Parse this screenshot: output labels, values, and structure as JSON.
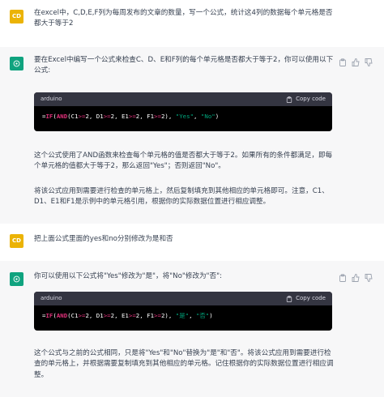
{
  "messages": [
    {
      "role": "user",
      "avatar": "CD",
      "text": "在excel中，C,D,E,F列为每周发布的文章的数量，写一个公式，统计这4列的数据每个单元格是否都大于等于2"
    },
    {
      "role": "assistant",
      "intro": "要在Excel中编写一个公式来检查C、D、E和F列的每个单元格是否都大于等于2，你可以使用以下公式:",
      "code": {
        "language": "arduino",
        "copy_label": "Copy code",
        "tokens": [
          {
            "t": "=",
            "c": "plain"
          },
          {
            "t": "IF",
            "c": "kw"
          },
          {
            "t": "(",
            "c": "plain"
          },
          {
            "t": "AND",
            "c": "kw"
          },
          {
            "t": "(C1",
            "c": "plain"
          },
          {
            "t": ">=",
            "c": "op"
          },
          {
            "t": "2",
            "c": "num"
          },
          {
            "t": ", D1",
            "c": "plain"
          },
          {
            "t": ">=",
            "c": "op"
          },
          {
            "t": "2",
            "c": "num"
          },
          {
            "t": ", E1",
            "c": "plain"
          },
          {
            "t": ">=",
            "c": "op"
          },
          {
            "t": "2",
            "c": "num"
          },
          {
            "t": ", F1",
            "c": "plain"
          },
          {
            "t": ">=",
            "c": "op"
          },
          {
            "t": "2",
            "c": "num"
          },
          {
            "t": "), ",
            "c": "plain"
          },
          {
            "t": "\"Yes\"",
            "c": "str"
          },
          {
            "t": ", ",
            "c": "plain"
          },
          {
            "t": "\"No\"",
            "c": "str"
          },
          {
            "t": ")",
            "c": "plain"
          }
        ]
      },
      "para1": "这个公式使用了AND函数来检查每个单元格的值是否都大于等于2。如果所有的条件都满足，即每个单元格的值都大于等于2，那么返回\"Yes\"；否则返回\"No\"。",
      "para2": "将该公式应用到需要进行检查的单元格上，然后复制填充到其他相应的单元格即可。注意，C1、D1、E1和F1是示例中的单元格引用，根据你的实际数据位置进行相应调整。"
    },
    {
      "role": "user",
      "avatar": "CD",
      "text": "把上面公式里面的yes和no分别修改为是和否"
    },
    {
      "role": "assistant",
      "intro": "你可以使用以下公式将\"Yes\"修改为\"是\"，将\"No\"修改为\"否\":",
      "code": {
        "language": "arduino",
        "copy_label": "Copy code",
        "tokens": [
          {
            "t": "=",
            "c": "plain"
          },
          {
            "t": "IF",
            "c": "kw"
          },
          {
            "t": "(",
            "c": "plain"
          },
          {
            "t": "AND",
            "c": "kw"
          },
          {
            "t": "(C1",
            "c": "plain"
          },
          {
            "t": ">=",
            "c": "op"
          },
          {
            "t": "2",
            "c": "num"
          },
          {
            "t": ", D1",
            "c": "plain"
          },
          {
            "t": ">=",
            "c": "op"
          },
          {
            "t": "2",
            "c": "num"
          },
          {
            "t": ", E1",
            "c": "plain"
          },
          {
            "t": ">=",
            "c": "op"
          },
          {
            "t": "2",
            "c": "num"
          },
          {
            "t": ", F1",
            "c": "plain"
          },
          {
            "t": ">=",
            "c": "op"
          },
          {
            "t": "2",
            "c": "num"
          },
          {
            "t": "), ",
            "c": "plain"
          },
          {
            "t": "\"是\"",
            "c": "str"
          },
          {
            "t": ", ",
            "c": "plain"
          },
          {
            "t": "\"否\"",
            "c": "str"
          },
          {
            "t": ")",
            "c": "plain"
          }
        ]
      },
      "para1": "这个公式与之前的公式相同，只是将\"Yes\"和\"No\"替换为\"是\"和\"否\"。将该公式应用到需要进行检查的单元格上，并根据需要复制填充到其他相应的单元格。记住根据你的实际数据位置进行相应调整。"
    }
  ],
  "colors": {
    "user_avatar": "#ebb305",
    "gpt_avatar": "#10a37f",
    "assistant_bg": "#f7f7f8",
    "code_bg": "#000000",
    "code_header_bg": "#343541",
    "keyword": "#df3079",
    "string": "#00a67d"
  },
  "icons": {
    "assistant_actions": [
      "clipboard-icon",
      "thumbs-up-icon",
      "thumbs-down-icon"
    ],
    "code_copy": "clipboard-icon"
  }
}
